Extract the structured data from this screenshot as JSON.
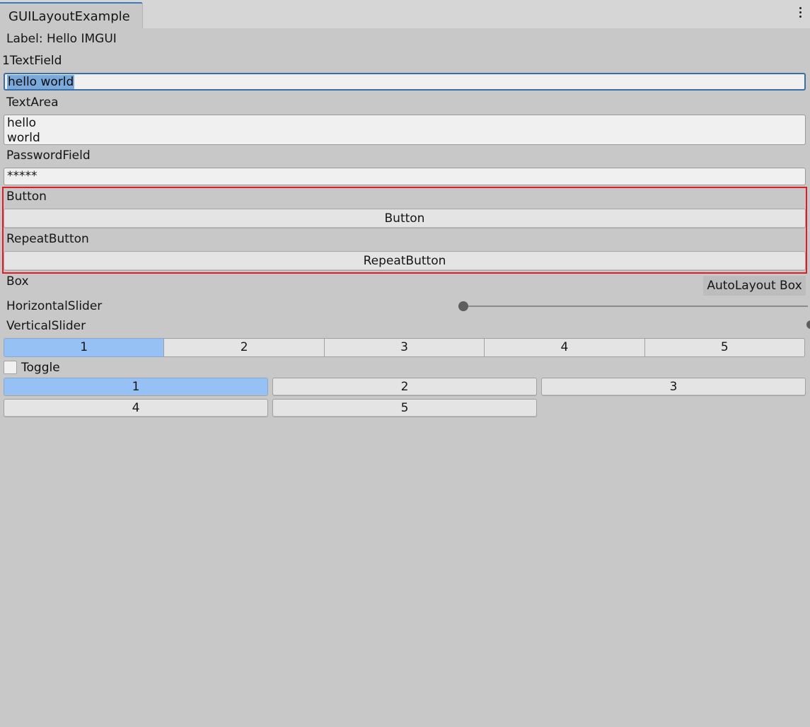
{
  "window": {
    "tab_title": "GUILayoutExample",
    "menu_icon": "kebab-menu-icon"
  },
  "label_line": "Label: Hello IMGUI",
  "textfield": {
    "caption": "TextField",
    "caption_prefix": "1",
    "value": "hello world"
  },
  "textarea": {
    "caption": "TextArea",
    "line1": "hello",
    "line2": "world"
  },
  "passwordfield": {
    "caption": "PasswordField",
    "value": "*****"
  },
  "button_section": {
    "caption": "Button",
    "button_label": "Button"
  },
  "repeat_section": {
    "caption": "RepeatButton",
    "button_label": "RepeatButton"
  },
  "box_section": {
    "caption": "Box",
    "box_label": "AutoLayout Box"
  },
  "horizontal_slider": {
    "caption": "HorizontalSlider",
    "value_fraction": 0.0
  },
  "vertical_slider": {
    "caption": "VerticalSlider"
  },
  "toolbar": {
    "selected": "1",
    "items": [
      "1",
      "2",
      "3",
      "4",
      "5"
    ]
  },
  "toggle": {
    "label": "Toggle",
    "checked": false
  },
  "selection_grid": {
    "selected": "1",
    "items": [
      "1",
      "2",
      "3",
      "4",
      "5"
    ]
  },
  "colors": {
    "background": "#c8c8c8",
    "selected_blue": "#96c1f5",
    "highlight_red": "#e01c24",
    "focus_border": "#3a6ea6"
  }
}
